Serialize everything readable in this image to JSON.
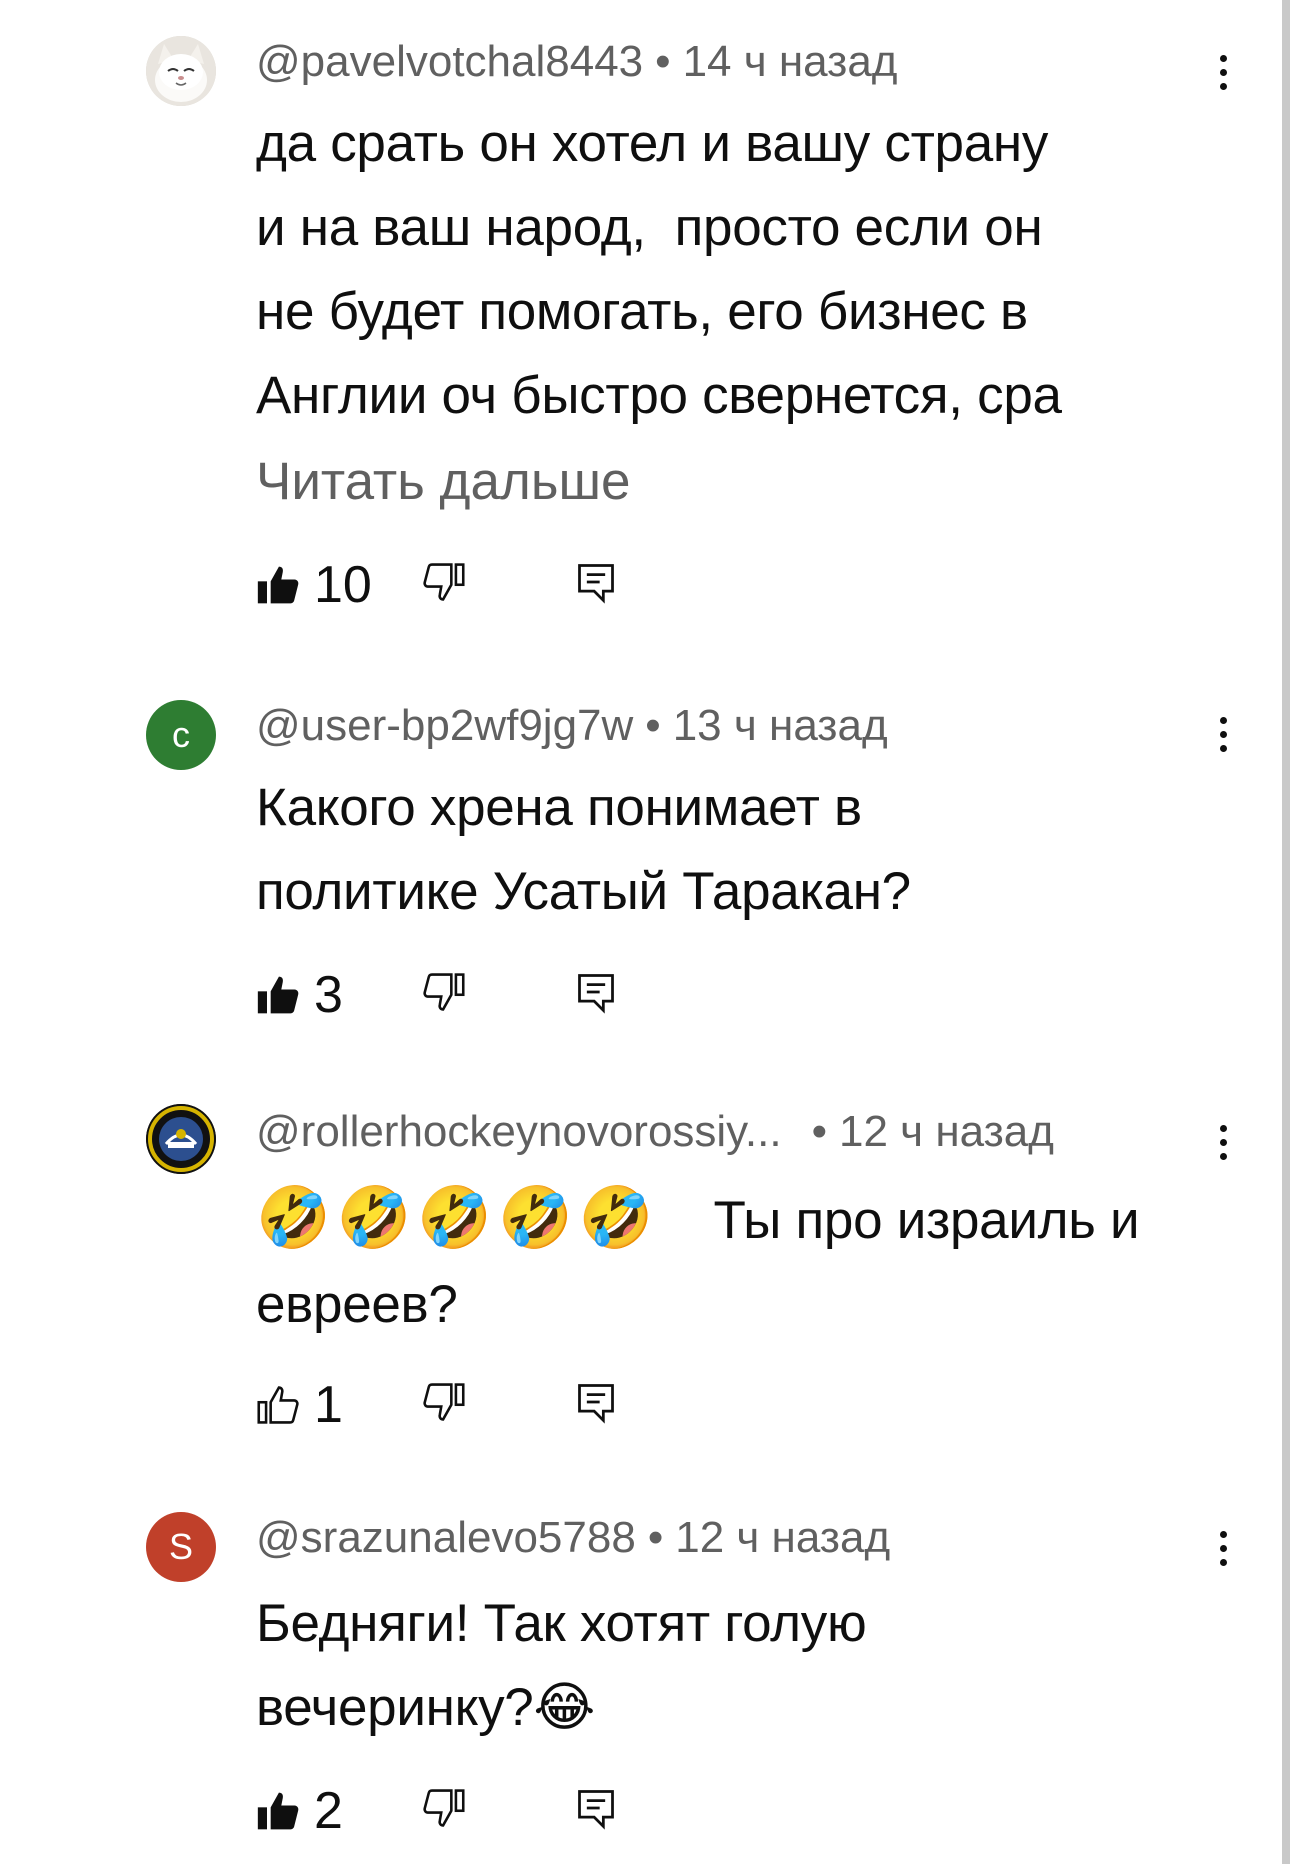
{
  "comments": [
    {
      "username": "@pavelvotchal8443",
      "time": "14 ч назад",
      "avatar": {
        "type": "photo",
        "name": "cat-avatar",
        "bg": "#d9d4cc"
      },
      "lines": [
        "да срать он хотел и вашу страну",
        "и на ваш народ,  просто если он",
        "не будет помогать, его бизнес в",
        "Англии оч быстро свернется, сра"
      ],
      "read_more": "Читать дальше",
      "likes": "10",
      "liked": true
    },
    {
      "username": "@user-bp2wf9jg7w",
      "time": "13 ч назад",
      "avatar": {
        "type": "letter",
        "letter": "с",
        "bg": "#2e7d32"
      },
      "lines": [
        "Какого хрена понимает в",
        "политике Усатый Таракан?"
      ],
      "likes": "3",
      "liked": true
    },
    {
      "username": "@rollerhockeynovorossiy...",
      "time": "12 ч назад",
      "avatar": {
        "type": "logo",
        "bg": "#1a1a1a"
      },
      "emoji_prefix": "🤣🤣🤣🤣🤣",
      "lines": [
        "Ты про израиль и",
        "евреев?"
      ],
      "likes": "1",
      "liked": false
    },
    {
      "username": "@srazunalevo5788",
      "time": "12 ч назад",
      "avatar": {
        "type": "letter",
        "letter": "S",
        "bg": "#c0402a"
      },
      "lines": [
        "Бедняги! Так хотят голую",
        "вечеринку?😂"
      ],
      "likes": "2",
      "liked": true
    }
  ],
  "colors": {
    "text": "#0f0f0f",
    "meta": "#606060",
    "background": "#ffffff"
  },
  "icons": {
    "like": "thumbs-up-icon",
    "dislike": "thumbs-down-icon",
    "reply": "reply-icon",
    "menu": "more-vertical-icon"
  }
}
